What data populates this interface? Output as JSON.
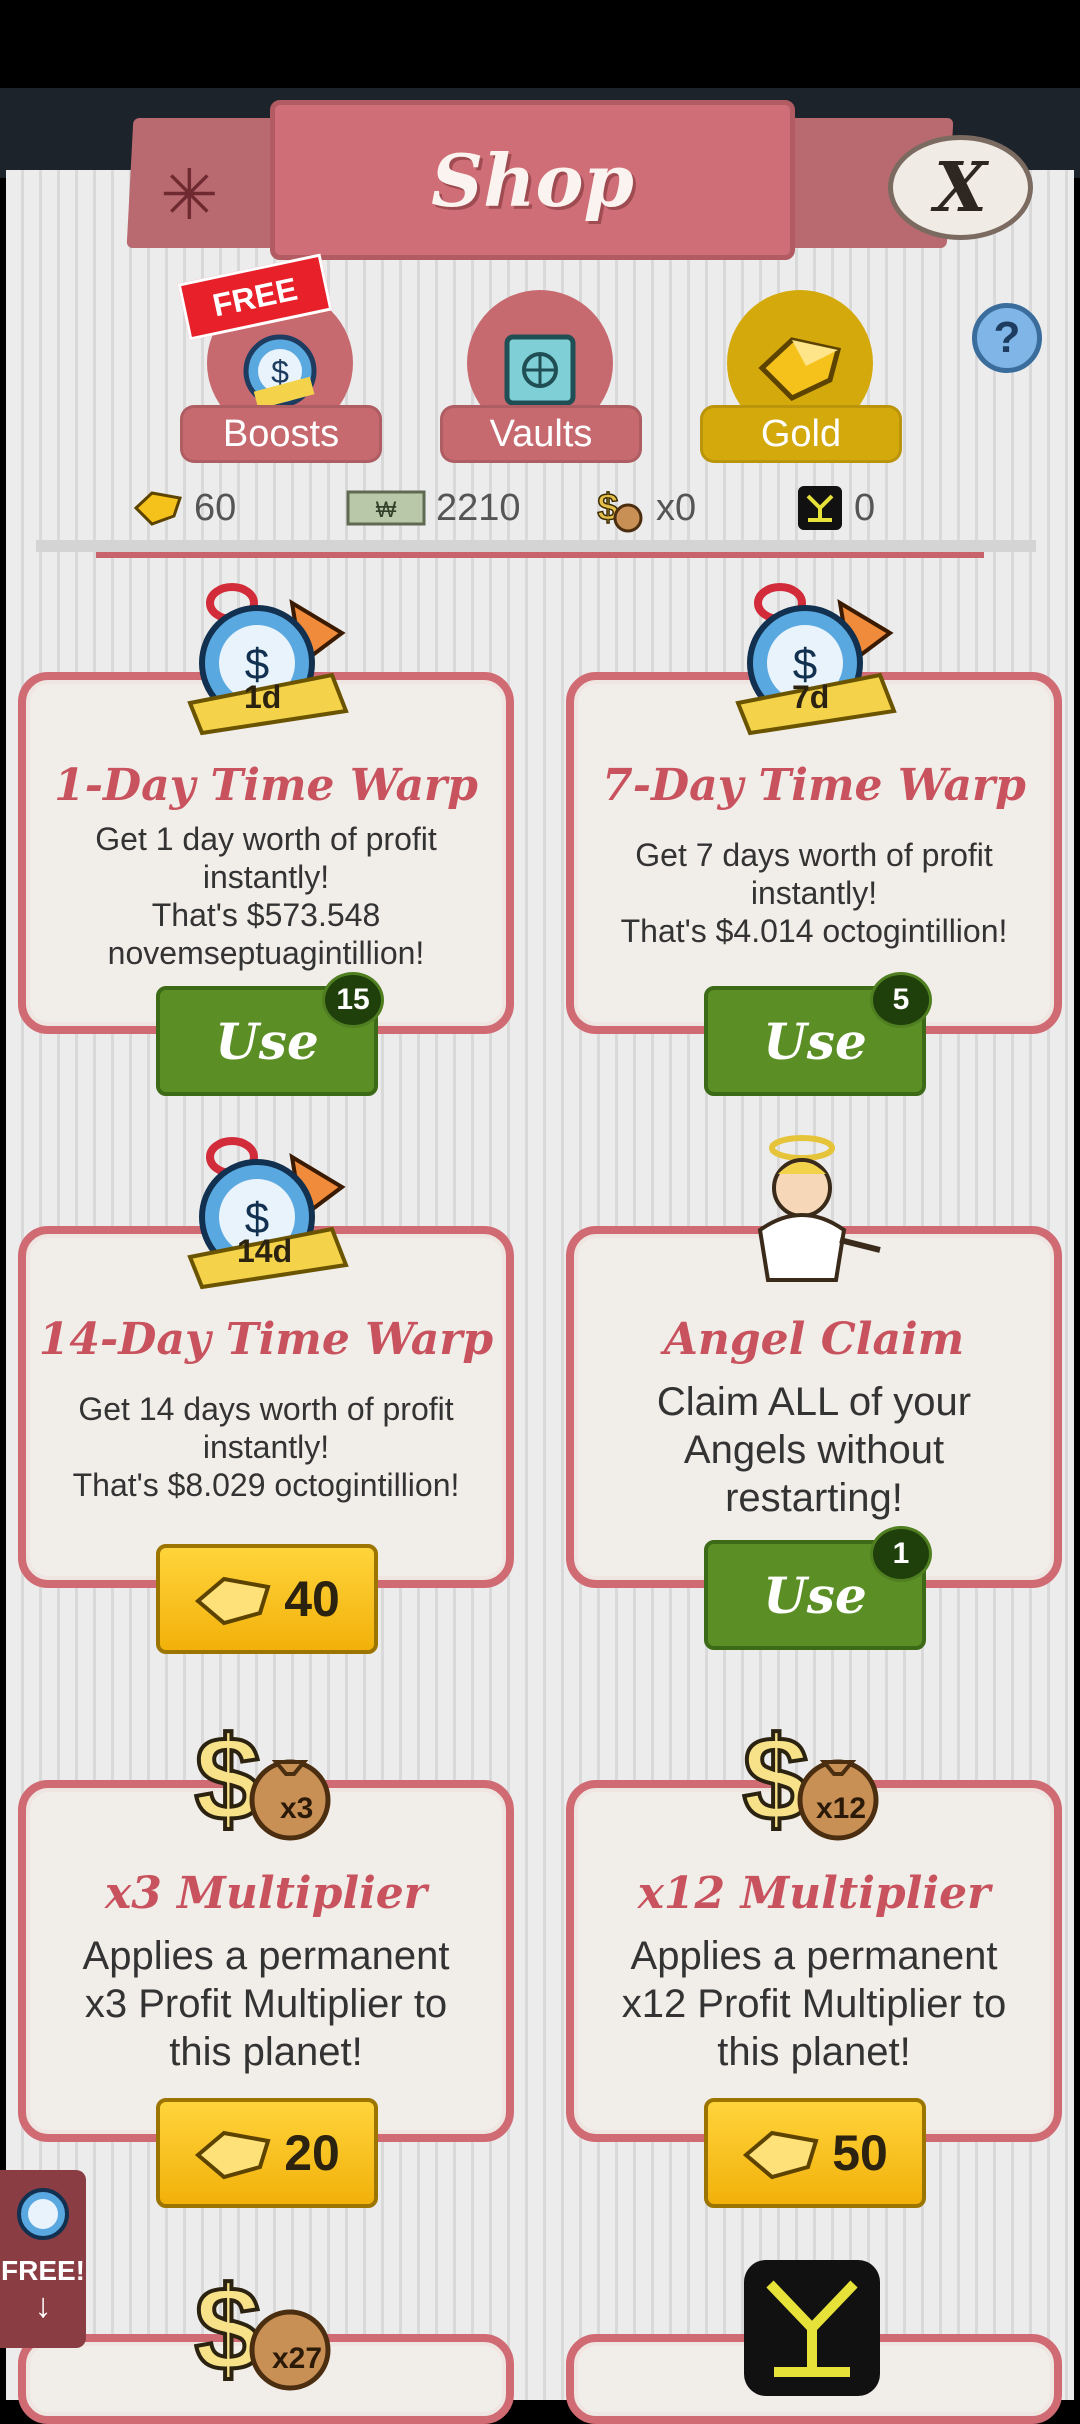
{
  "header": {
    "title": "Shop",
    "close_label": "X"
  },
  "tabs": [
    {
      "label": "Boosts",
      "badge": "FREE",
      "color": "#c76a70"
    },
    {
      "label": "Vaults",
      "color": "#c76a70"
    },
    {
      "label": "Gold",
      "color": "#d4a90c",
      "active": true
    }
  ],
  "help_label": "?",
  "currencies": [
    {
      "icon": "gold-icon",
      "value": "60"
    },
    {
      "icon": "megabucks-icon",
      "value": "2210"
    },
    {
      "icon": "moneybag-icon",
      "value": "x0"
    },
    {
      "icon": "flux-icon",
      "value": "0"
    }
  ],
  "items": [
    {
      "title": "1-Day Time Warp",
      "icon_label": "1d",
      "desc": [
        "Get 1 day worth of profit",
        "instantly!",
        "That's $573.548",
        "novemseptuagintillion!"
      ],
      "action": "use",
      "action_label": "Use",
      "count": "15"
    },
    {
      "title": "7-Day Time Warp",
      "icon_label": "7d",
      "desc": [
        "Get 7 days worth of profit",
        "instantly!",
        "That's $4.014 octogintillion!"
      ],
      "action": "use",
      "action_label": "Use",
      "count": "5"
    },
    {
      "title": "14-Day Time Warp",
      "icon_label": "14d",
      "desc": [
        "Get 14 days worth of profit",
        "instantly!",
        "That's $8.029 octogintillion!"
      ],
      "action": "buy",
      "price": "40"
    },
    {
      "title": "Angel Claim",
      "desc": [
        "Claim ALL of your",
        "Angels without",
        "restarting!"
      ],
      "action": "use",
      "action_label": "Use",
      "count": "1"
    },
    {
      "title": "x3 Multiplier",
      "icon_label": "x3",
      "desc": [
        "Applies a permanent",
        "x3 Profit Multiplier to",
        "this planet!"
      ],
      "action": "buy",
      "price": "20"
    },
    {
      "title": "x12 Multiplier",
      "icon_label": "x12",
      "desc": [
        "Applies a permanent",
        "x12 Profit Multiplier to",
        "this planet!"
      ],
      "action": "buy",
      "price": "50"
    }
  ],
  "partial_items": [
    {
      "icon_label": "x27"
    },
    {
      "icon": "flux-icon"
    }
  ],
  "side_free": {
    "label": "FREE!",
    "arrow": "↓"
  }
}
